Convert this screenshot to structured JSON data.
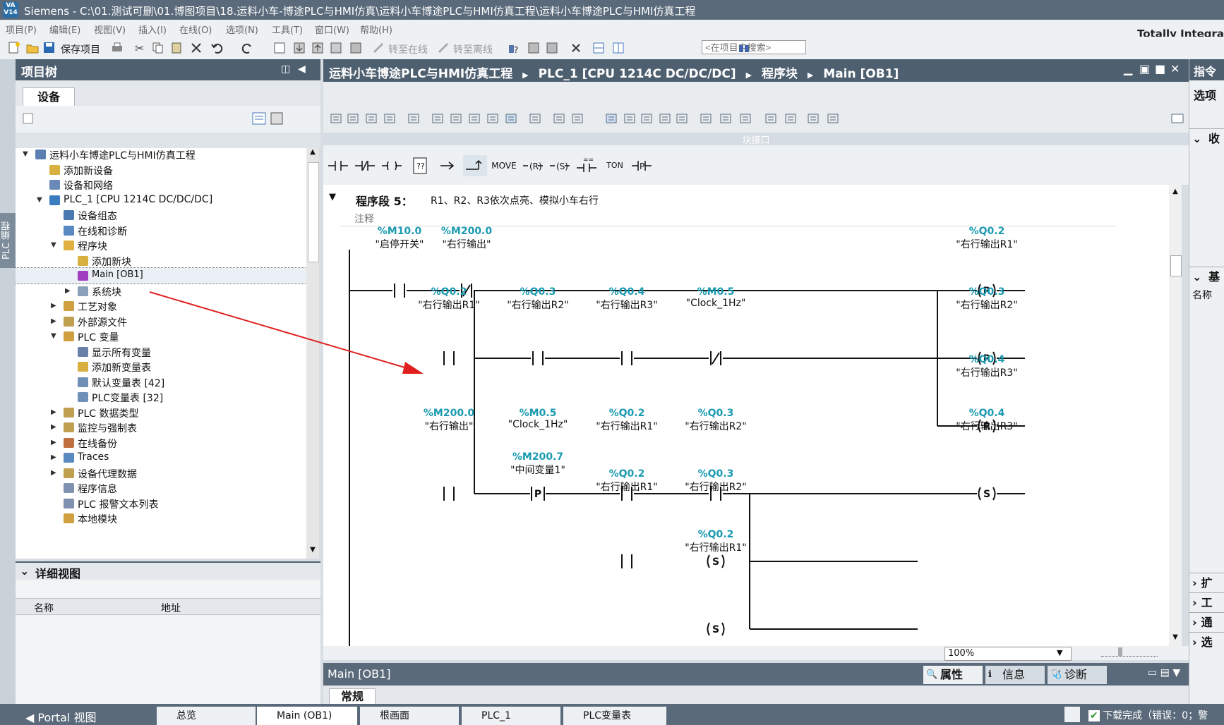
{
  "window": {
    "logo": "VA V14",
    "title": "Siemens  -  C:\\01.测试可删\\01.博图项目\\18.运料小车-博途PLC与HMI仿真\\运料小车博途PLC与HMI仿真工程\\运料小车博途PLC与HMI仿真工程",
    "brand": "Totally Integra"
  },
  "menu": [
    "项目(P)",
    "编辑(E)",
    "视图(V)",
    "插入(I)",
    "在线(O)",
    "选项(N)",
    "工具(T)",
    "窗口(W)",
    "帮助(H)"
  ],
  "toolbar": {
    "save_label": "保存项目",
    "go_online": "转至在线",
    "go_offline": "转至离线",
    "search_placeholder": "<在项目中搜索>"
  },
  "left_strip_label": "PLC 编程",
  "project_tree": {
    "header": "项目树",
    "tab": "设备",
    "items": [
      {
        "label": "运料小车博途PLC与HMI仿真工程",
        "expanded": true
      },
      {
        "label": "添加新设备"
      },
      {
        "label": "设备和网络"
      },
      {
        "label": "PLC_1 [CPU 1214C DC/DC/DC]",
        "expanded": true
      },
      {
        "label": "设备组态"
      },
      {
        "label": "在线和诊断"
      },
      {
        "label": "程序块",
        "expanded": true
      },
      {
        "label": "添加新块"
      },
      {
        "label": "Main [OB1]",
        "selected": true
      },
      {
        "label": "系统块"
      },
      {
        "label": "工艺对象"
      },
      {
        "label": "外部源文件"
      },
      {
        "label": "PLC 变量",
        "expanded": true
      },
      {
        "label": "显示所有变量"
      },
      {
        "label": "添加新变量表"
      },
      {
        "label": "默认变量表 [42]"
      },
      {
        "label": "PLC变量表 [32]"
      },
      {
        "label": "PLC 数据类型"
      },
      {
        "label": "监控与强制表"
      },
      {
        "label": "在线备份"
      },
      {
        "label": "Traces"
      },
      {
        "label": "设备代理数据"
      },
      {
        "label": "程序信息"
      },
      {
        "label": "PLC 报警文本列表"
      },
      {
        "label": "本地模块"
      }
    ]
  },
  "detail_view": {
    "header": "详细视图",
    "col_name": "名称",
    "col_address": "地址"
  },
  "editor": {
    "breadcrumb": [
      "运料小车博途PLC与HMI仿真工程",
      "PLC_1 [CPU 1214C DC/DC/DC]",
      "程序块",
      "Main [OB1]"
    ],
    "block_interface": "块接口",
    "ladder_buttons": [
      "MOVE",
      "TON"
    ],
    "network_title": "程序段 5：",
    "network_desc": "R1、R2、R3依次点亮、模拟小车右行",
    "comment": "注释",
    "zoom": "100%"
  },
  "ladder": {
    "r1": [
      {
        "addr": "%M10.0",
        "name": "\"启停开关\"",
        "coil": ""
      },
      {
        "addr": "%M200.0",
        "name": "\"右行输出\"",
        "coil": ""
      },
      {
        "addr": "%Q0.2",
        "name": "\"右行输出R1\"",
        "coil": "R"
      }
    ],
    "r2": [
      {
        "addr": "%Q0.2",
        "name": "\"右行输出R1\""
      },
      {
        "addr": "%Q0.3",
        "name": "\"右行输出R2\""
      },
      {
        "addr": "%Q0.4",
        "name": "\"右行输出R3\""
      },
      {
        "addr": "%M0.5",
        "name": "\"Clock_1Hz\""
      },
      {
        "addr": "%Q0.3",
        "name": "\"右行输出R2\"",
        "coil": "R"
      }
    ],
    "r3": [
      {
        "addr": "%Q0.4",
        "name": "\"右行输出R3\"",
        "coil": "R"
      }
    ],
    "r4": [
      {
        "addr": "%M200.0",
        "name": "\"右行输出\""
      },
      {
        "addr": "%M0.5",
        "name": "\"Clock_1Hz\"",
        "coil": "P"
      },
      {
        "addr": "%Q0.2",
        "name": "\"右行输出R1\""
      },
      {
        "addr": "%Q0.3",
        "name": "\"右行输出R2\""
      },
      {
        "addr": "%Q0.4",
        "name": "\"右行输出R3\"",
        "coil": "S"
      }
    ],
    "p_operand": {
      "addr": "%M200.7",
      "name": "\"中间变量1\""
    },
    "r5": [
      {
        "addr": "%Q0.2",
        "name": "\"右行输出R1\""
      },
      {
        "addr": "%Q0.3",
        "name": "\"右行输出R2\"",
        "coil": "S"
      }
    ],
    "r6": [
      {
        "addr": "%Q0.2",
        "name": "\"右行输出R1\"",
        "coil": "S"
      }
    ],
    "coil_labels": {
      "R": "R",
      "S": "S",
      "P": "P"
    }
  },
  "inspector": {
    "tabs": [
      "属性",
      "信息",
      "诊断"
    ],
    "general": "常规"
  },
  "taskbar": {
    "portal": "Portal 视图",
    "items": [
      "总览",
      "Main (OB1)",
      "根画面",
      "PLC_1",
      "PLC变量表"
    ],
    "status": "下载完成（错误：0；警"
  },
  "right_panel": {
    "title": "指令",
    "options": "选项",
    "fav": "收",
    "basic": "基",
    "name_col": "名称",
    "sections": [
      "扩",
      "工",
      "通",
      "选"
    ]
  },
  "colors": {
    "accent": "#4e5f70",
    "operand": "#1a9ab0",
    "arrow": "#e02020"
  }
}
